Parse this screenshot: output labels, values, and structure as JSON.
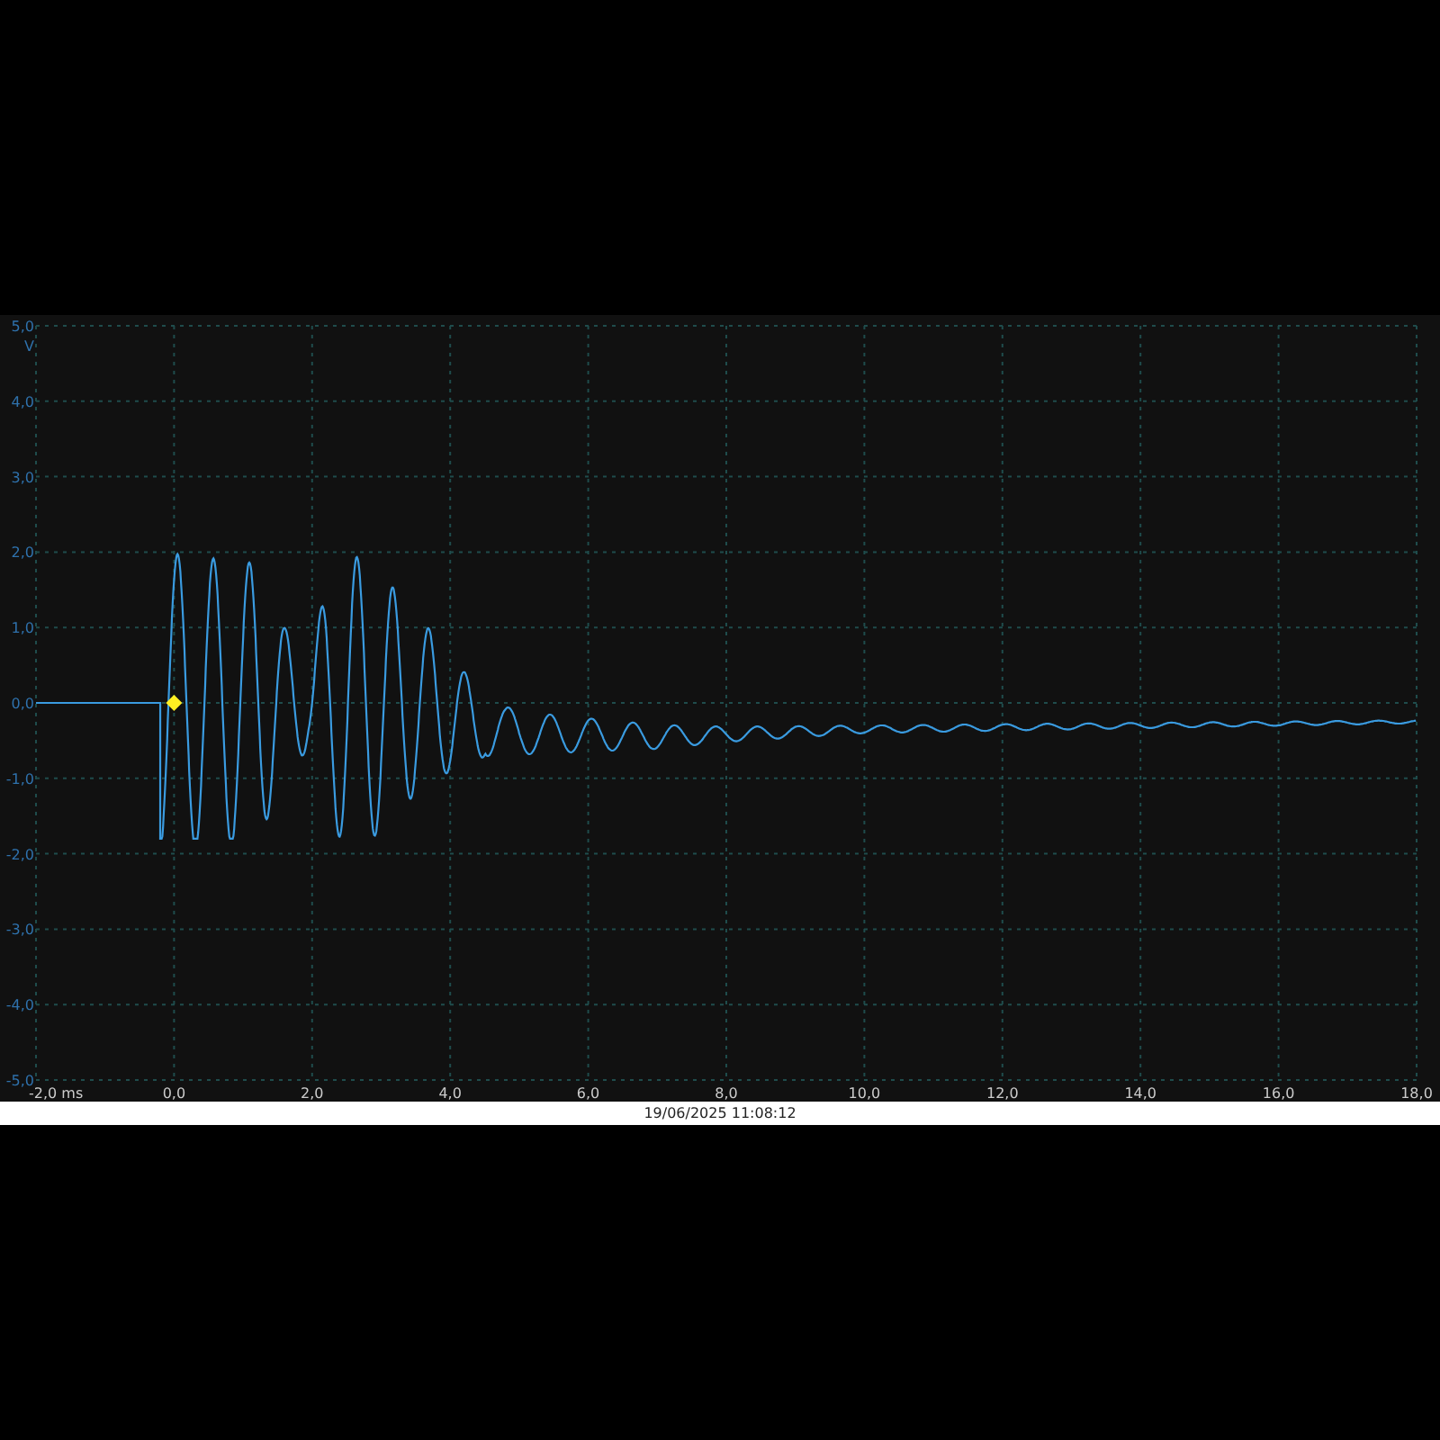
{
  "chart": {
    "y_unit": "V",
    "y_ticks": [
      "5,0",
      "4,0",
      "3,0",
      "2,0",
      "1,0",
      "0,0",
      "-1,0",
      "-2,0",
      "-3,0",
      "-4,0",
      "-5,0"
    ],
    "x_ticks": [
      "-2,0 ms",
      "0,0",
      "2,0",
      "4,0",
      "6,0",
      "8,0",
      "10,0",
      "12,0",
      "14,0",
      "16,0",
      "18,0"
    ]
  },
  "status_bar": {
    "timestamp": "19/06/2025 11:08:12"
  }
}
